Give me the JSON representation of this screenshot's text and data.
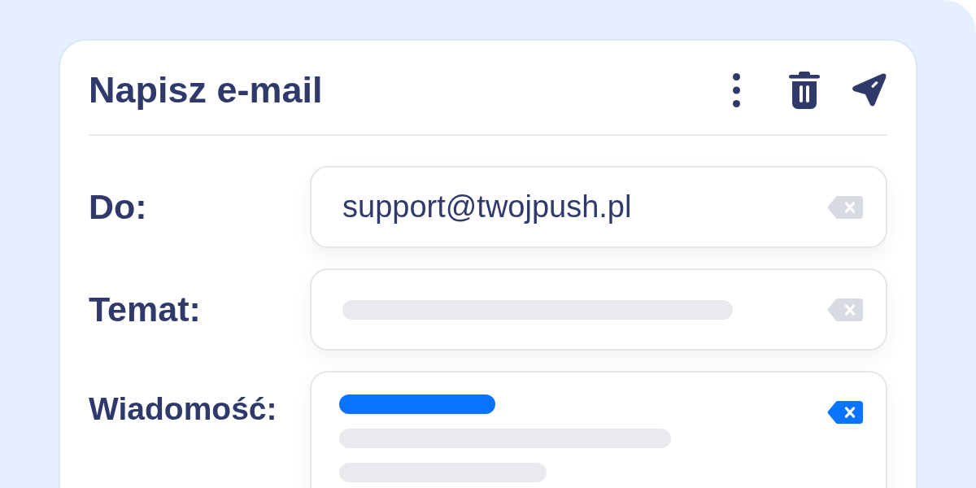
{
  "header": {
    "title": "Napisz e-mail"
  },
  "fields": [
    {
      "label": "Do:",
      "kind": "text",
      "value": "support@twojpush.pl",
      "active": false
    },
    {
      "label": "Temat:",
      "kind": "lines",
      "active": false,
      "lines": [
        {
          "accent": false
        }
      ]
    },
    {
      "label": "Wiadomość:",
      "kind": "lines",
      "active": true,
      "lines": [
        {
          "accent": true
        },
        {
          "accent": false
        },
        {
          "accent": false
        }
      ]
    }
  ]
}
